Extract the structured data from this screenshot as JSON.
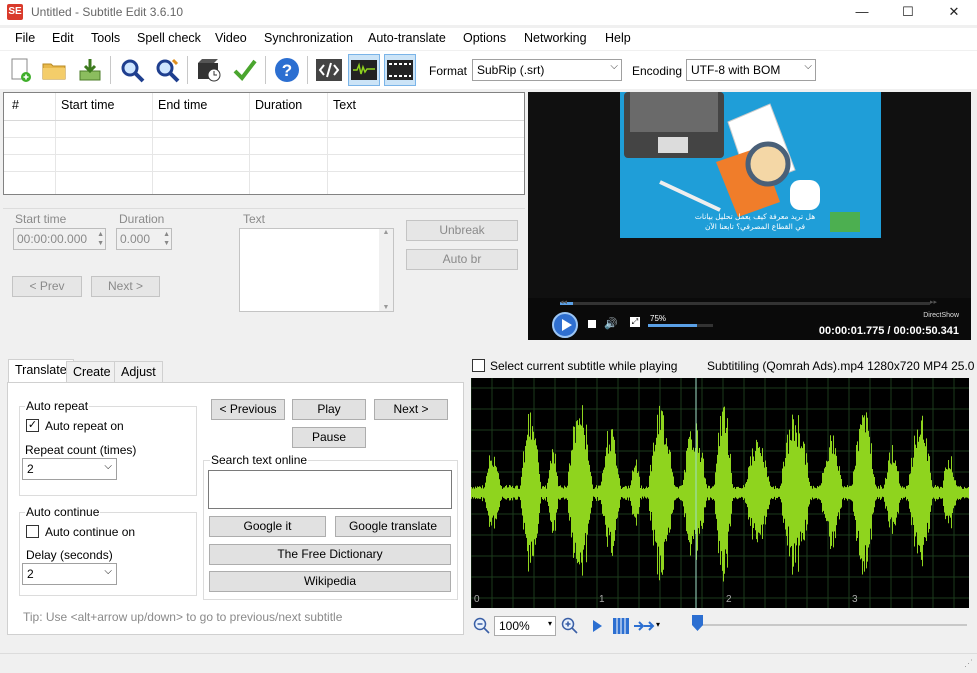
{
  "window": {
    "title": "Untitled - Subtitle Edit 3.6.10",
    "app_icon_text": "SE",
    "minimize": "—",
    "maximize": "☐",
    "close": "✕"
  },
  "menu": [
    "File",
    "Edit",
    "Tools",
    "Spell check",
    "Video",
    "Synchronization",
    "Auto-translate",
    "Options",
    "Networking",
    "Help"
  ],
  "toolbar": {
    "icons": [
      "new-file-icon",
      "open-folder-icon",
      "save-download-icon",
      "find-icon",
      "replace-icon",
      "visual-sync-icon",
      "spell-check-icon",
      "help-icon",
      "source-view-icon",
      "waveform-toggle-icon",
      "video-toggle-icon"
    ],
    "format_label": "Format",
    "format_value": "SubRip (.srt)",
    "encoding_label": "Encoding",
    "encoding_value": "UTF-8 with BOM"
  },
  "grid": {
    "columns": [
      "#",
      "Start time",
      "End time",
      "Duration",
      "Text"
    ]
  },
  "edit": {
    "start_time_label": "Start time",
    "start_time_value": "00:00:00.000",
    "duration_label": "Duration",
    "duration_value": "0.000",
    "text_label": "Text",
    "unbreak": "Unbreak",
    "auto_br": "Auto br",
    "prev": "< Prev",
    "next": "Next >"
  },
  "video": {
    "subtitle_line1": "هل تريد معرفة كيف يعمل تحليل بيانات",
    "subtitle_line2": "في القطاع المصرفي؟ تابعنا الآن",
    "renderer": "DirectShow",
    "volume_percent": "75%",
    "position": "00:00:01.775",
    "separator": " / ",
    "duration": "00:00:50.341",
    "progress_fraction": 0.035
  },
  "tabs": [
    "Translate",
    "Create",
    "Adjust"
  ],
  "translate": {
    "auto_repeat_group": "Auto repeat",
    "auto_repeat_on": "Auto repeat on",
    "auto_repeat_checked": true,
    "repeat_count_label": "Repeat count (times)",
    "repeat_count_value": "2",
    "auto_continue_group": "Auto continue",
    "auto_continue_on": "Auto continue on",
    "auto_continue_checked": false,
    "delay_label": "Delay (seconds)",
    "delay_value": "2",
    "previous": "< Previous",
    "play": "Play",
    "next": "Next >",
    "pause": "Pause",
    "search_group": "Search text online",
    "google_it": "Google it",
    "google_translate": "Google translate",
    "free_dictionary": "The Free Dictionary",
    "wikipedia": "Wikipedia",
    "tip": "Tip: Use <alt+arrow up/down> to go to previous/next subtitle"
  },
  "waveform": {
    "select_current_label": "Select current subtitle while playing",
    "file_info": "Subtitiling (Qomrah Ads).mp4 1280x720 MP4 25.0",
    "tick_labels": [
      "0",
      "1",
      "2",
      "3"
    ],
    "zoom_value": "100%",
    "color": "#8fd41e"
  }
}
